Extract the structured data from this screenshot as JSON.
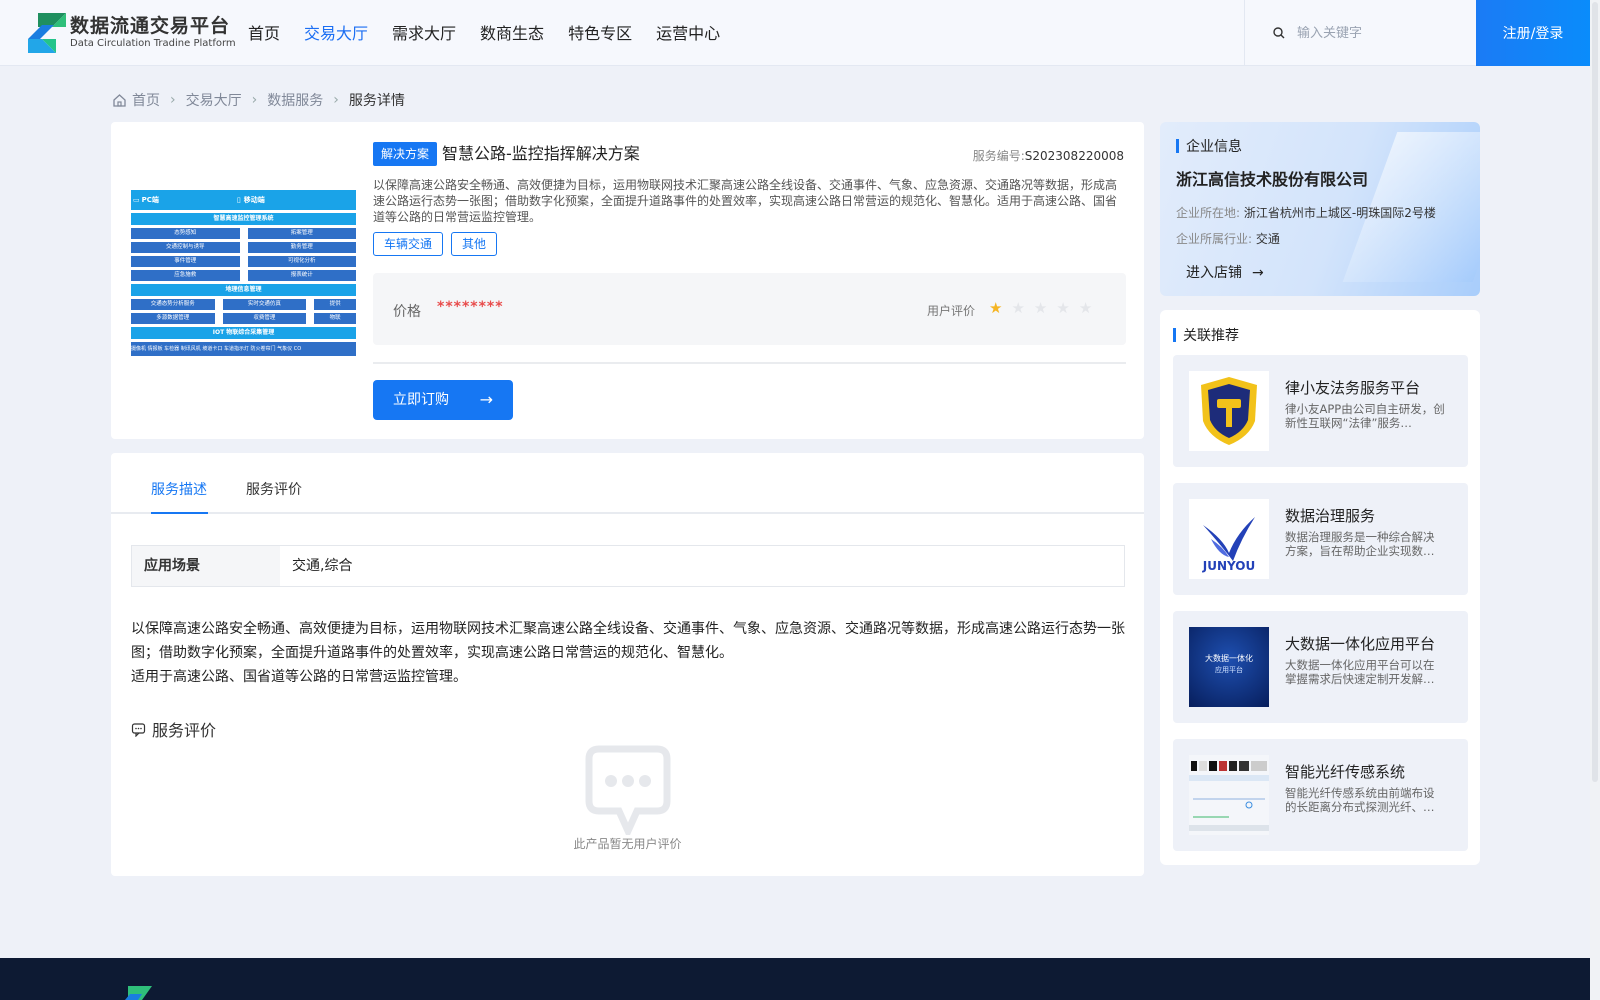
{
  "header": {
    "logo_cn": "数据流通交易平台",
    "logo_en": "Data Circulation Tradine Platform",
    "nav": [
      "首页",
      "交易大厅",
      "需求大厅",
      "数商生态",
      "特色专区",
      "运营中心"
    ],
    "active_nav": 1,
    "search_placeholder": "输入关键字",
    "login_label": "注册/登录"
  },
  "breadcrumb": [
    "首页",
    "交易大厅",
    "数据服务",
    "服务详情"
  ],
  "product": {
    "tag": "解决方案",
    "title": "智慧公路-监控指挥解决方案",
    "service_no_label": "服务编号:",
    "service_no": "S202308220008",
    "description": "以保障高速公路安全畅通、高效便捷为目标，运用物联网技术汇聚高速公路全线设备、交通事件、气象、应急资源、交通路况等数据，形成高速公路运行态势一张图；借助数字化预案，全面提升道路事件的处置效率，实现高速公路日常营运的规范化、智慧化。适用于高速公路、国省道等公路的日常营运监控管理。",
    "chips": [
      "车辆交通",
      "其他"
    ],
    "price_label": "价格",
    "price_value": "********",
    "rating_label": "用户评价",
    "rating": 1,
    "rating_max": 5,
    "order_label": "立即订购",
    "image": {
      "tab_pc": "PC端",
      "tab_mobile": "移动端",
      "bar1": "智慧高速监控管理系统",
      "row1": [
        "态势感知",
        "拓案管理"
      ],
      "row2": [
        "交通控制与诱导",
        "勤务管理"
      ],
      "row3": [
        "事件管理",
        "可视化分析"
      ],
      "row4": [
        "应急施救",
        "报表统计"
      ],
      "bar2": "地理信息管理",
      "row5": [
        "交通态势分析服务",
        "实时交通仿真",
        "提供"
      ],
      "row6": [
        "多源数据管理",
        "収费管理",
        "物联"
      ],
      "bar3": "IOT 物联综合采集管理",
      "footer": "摄像机 情报板 车检器 制讯风机 坡道卡口 车道指示灯 防火卷帘门 气象仪 CO"
    }
  },
  "company": {
    "section_title": "企业信息",
    "name": "浙江高信技术股份有限公司",
    "location_label": "企业所在地:",
    "location": "浙江省杭州市上城区-明珠国际2号楼",
    "industry_label": "企业所属行业:",
    "industry": "交通",
    "shop_label": "进入店铺"
  },
  "related": {
    "section_title": "关联推荐",
    "items": [
      {
        "title": "律小友法务服务平台",
        "desc": "律小友APP由公司自主研发，创新性互联网“法律”服务…"
      },
      {
        "title": "数据治理服务",
        "desc": "数据治理服务是一种综合解决方案，旨在帮助企业实现数…",
        "logo_text": "JUNYOU"
      },
      {
        "title": "大数据一体化应用平台",
        "desc": "大数据一体化应用平台可以在掌握需求后快速定制开发解…",
        "img_text1": "大数据一体化",
        "img_text2": "应用平台"
      },
      {
        "title": "智能光纤传感系统",
        "desc": "智能光纤传感系统由前端布设的长距离分布式探测光纤、…"
      }
    ]
  },
  "detail": {
    "tabs": [
      "服务描述",
      "服务评价"
    ],
    "scene_key": "应用场景",
    "scene_val": "交通,综合",
    "body_line1": "以保障高速公路安全畅通、高效便捷为目标，运用物联网技术汇聚高速公路全线设备、交通事件、气象、应急资源、交通路况等数据，形成高速公路运行态势一张图；借助数字化预案，全面提升道路事件的处置效率，实现高速公路日常营运的规范化、智慧化。",
    "body_line2": "适用于高速公路、国省道等公路的日常营运监控管理。",
    "review_title": "服务评价",
    "empty_text": "此产品暂无用户评价"
  },
  "colors": {
    "primary": "#1677f3",
    "price": "#e84c4c",
    "star_on": "#f5b523",
    "footer": "#0d1a33"
  }
}
